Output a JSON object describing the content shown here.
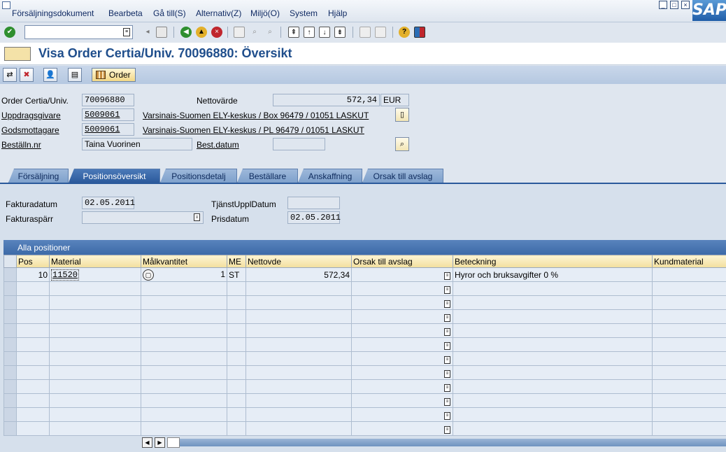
{
  "menu": {
    "items": [
      "Försäljningsdokument",
      "Bearbeta",
      "Gå till(S)",
      "Alternativ(Z)",
      "Miljö(O)",
      "System",
      "Hjälp"
    ]
  },
  "window": {
    "logo": "SAP"
  },
  "toolbar": {
    "command_value": "",
    "icons": [
      "enter-check-icon",
      "back-icon",
      "exit-icon",
      "cancel-icon",
      "print-icon",
      "find-icon",
      "find-next-icon",
      "first-page-icon",
      "prev-page-icon",
      "next-page-icon",
      "last-page-icon",
      "new-session-icon",
      "shortcut-icon",
      "help-icon",
      "customize-layout-icon"
    ]
  },
  "title": "Visa Order Certia/Univ. 70096880: Översikt",
  "app_toolbar": {
    "order_label": "Order"
  },
  "header": {
    "order_label": "Order Certia/Univ.",
    "order_value": "70096880",
    "net_value_label": "Nettovärde",
    "net_value": "572,34",
    "currency": "EUR",
    "sold_to_label": "Uppdragsgivare",
    "sold_to_value": "5009061",
    "sold_to_text": "Varsinais-Suomen ELY-keskus / Box 96479 / 01051 LASKUT",
    "ship_to_label": "Godsmottagare",
    "ship_to_value": "5009061",
    "ship_to_text": "Varsinais-Suomen ELY-keskus / PL 96479 / 01051 LASKUT",
    "po_label": "Beställn.nr",
    "po_value": "Taina Vuorinen",
    "po_date_label": "Best.datum",
    "po_date_value": ""
  },
  "tabs": [
    {
      "label": "Försäljning",
      "active": false
    },
    {
      "label": "Positionsöversikt",
      "active": true
    },
    {
      "label": "Positionsdetalj",
      "active": false
    },
    {
      "label": "Beställare",
      "active": false
    },
    {
      "label": "Anskaffning",
      "active": false
    },
    {
      "label": "Orsak till avslag",
      "active": false
    }
  ],
  "panel": {
    "billing_date_label": "Fakturadatum",
    "billing_date_value": "02.05.2011",
    "billing_block_label": "Fakturaspärr",
    "billing_block_value": "",
    "service_date_label": "TjänstUpplDatum",
    "service_date_value": "",
    "pricing_date_label": "Prisdatum",
    "pricing_date_value": "02.05.2011"
  },
  "items_table": {
    "title": "Alla positioner",
    "columns": [
      "Pos",
      "Material",
      "Målkvantitet",
      "ME",
      "Nettovde",
      "Orsak till avslag",
      "Beteckning",
      "Kundmaterial"
    ],
    "rows": [
      {
        "pos": "10",
        "material": "11520",
        "quantity": "1",
        "unit": "ST",
        "net_value": "572,34",
        "rejection": "",
        "description": "Hyror och bruksavgifter 0 %",
        "customer_material": ""
      }
    ],
    "empty_rows": 11
  }
}
